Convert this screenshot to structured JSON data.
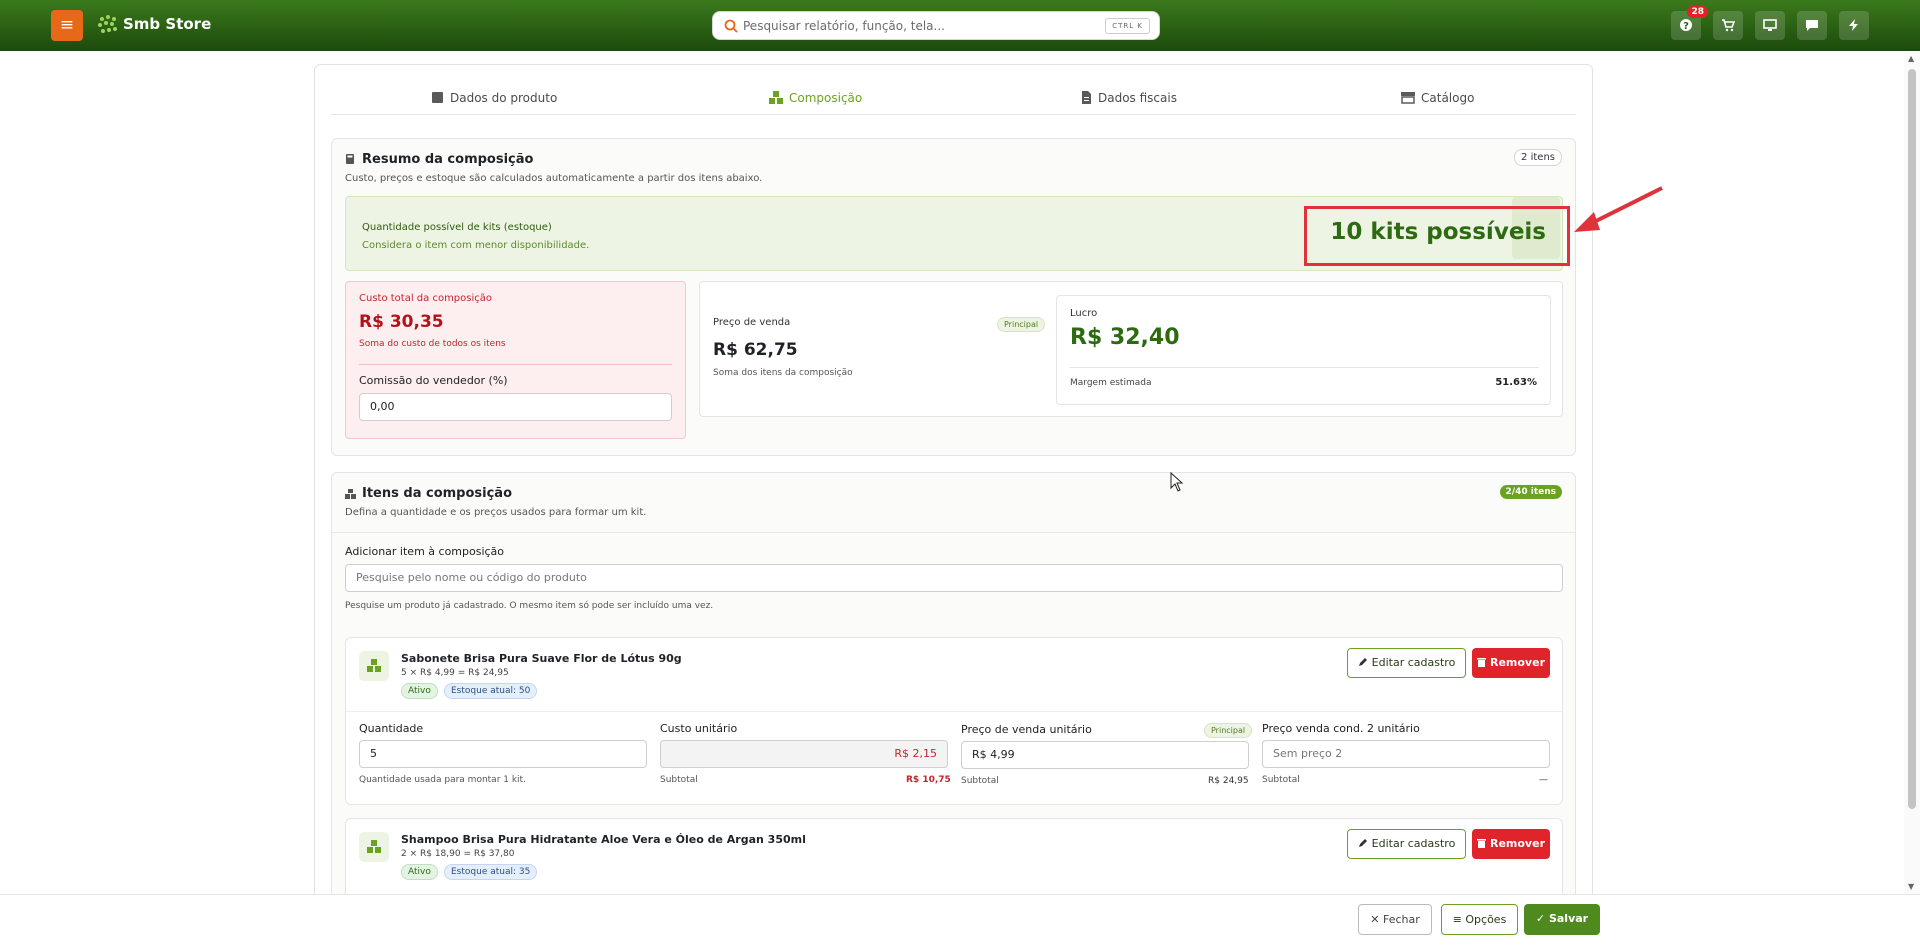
{
  "header": {
    "brand": "Smb Store",
    "search_placeholder": "Pesquisar relatório, função, tela...",
    "search_kbd": "CTRL K",
    "notif_count": "28"
  },
  "tabs": [
    {
      "label": "Dados do produto"
    },
    {
      "label": "Composição"
    },
    {
      "label": "Dados fiscais"
    },
    {
      "label": "Catálogo"
    }
  ],
  "summary": {
    "title": "Resumo da composição",
    "subtitle": "Custo, preços e estoque são calculados automaticamente a partir dos itens abaixo.",
    "count": "2 itens",
    "kits_label": "Quantidade possível de kits (estoque)",
    "kits_hint": "Considera o item com menor disponibilidade.",
    "kits_value": "10 kits possíveis",
    "cost_label": "Custo total da composição",
    "cost_value": "R$ 30,35",
    "cost_hint": "Soma do custo de todos os itens",
    "commission_label": "Comissão do vendedor (%)",
    "commission_value": "0,00",
    "price_label": "Preço de venda",
    "price_badge": "Principal",
    "price_value": "R$ 62,75",
    "price_hint": "Soma dos itens da composição",
    "profit_label": "Lucro",
    "profit_value": "R$ 32,40",
    "margin_label": "Margem estimada",
    "margin_value": "51.63%"
  },
  "items_section": {
    "title": "Itens da composição",
    "subtitle": "Defina a quantidade e os preços usados para formar um kit.",
    "count": "2/40 itens",
    "add_label": "Adicionar item à composição",
    "add_placeholder": "Pesquise pelo nome ou código do produto",
    "add_hint": "Pesquise um produto já cadastrado. O mesmo item só pode ser incluído uma vez.",
    "edit_label": "Editar cadastro",
    "remove_label": "Remover",
    "items": [
      {
        "name": "Sabonete Brisa Pura Suave Flor de Lótus 90g",
        "calc": "5 × R$ 4,99 = R$ 24,95",
        "status": "Ativo",
        "stock": "Estoque atual: 50",
        "qty_label": "Quantidade",
        "qty_value": "5",
        "qty_hint": "Quantidade usada para montar 1 kit.",
        "cost_label": "Custo unitário",
        "cost_value": "R$ 2,15",
        "subtotal_label": "Subtotal",
        "cost_subtotal": "R$ 10,75",
        "price_label": "Preço de venda unitário",
        "price_badge": "Principal",
        "price_value": "R$ 4,99",
        "price_subtotal": "R$ 24,95",
        "price2_label": "Preço venda cond. 2 unitário",
        "price2_placeholder": "Sem preço 2",
        "price2_subtotal": "—"
      },
      {
        "name": "Shampoo Brisa Pura Hidratante Aloe Vera e Óleo de Argan 350ml",
        "calc": "2 × R$ 18,90 = R$ 37,80",
        "status": "Ativo",
        "stock": "Estoque atual: 35"
      }
    ]
  },
  "footer": {
    "close": "Fechar",
    "options": "Opções",
    "save": "Salvar"
  },
  "colors": {
    "brand_green": "#2e6a12",
    "accent_green": "#6aa321",
    "menu_orange": "#e8681a",
    "danger_red": "#e0242c"
  }
}
